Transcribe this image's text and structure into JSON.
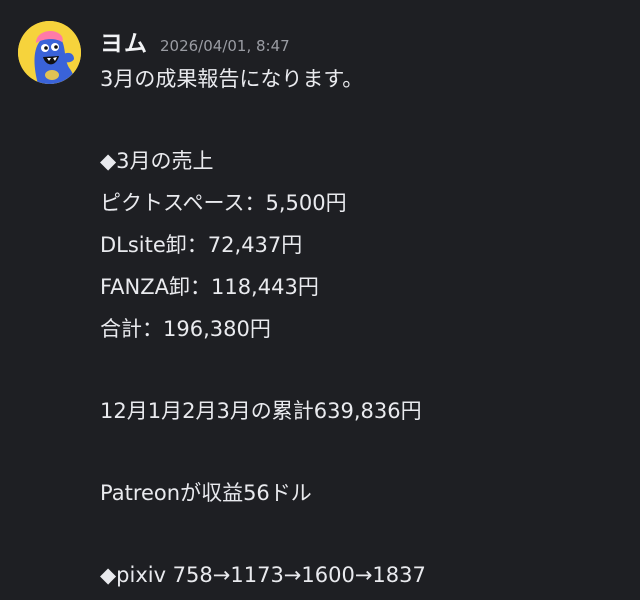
{
  "message": {
    "author": "ヨム",
    "timestamp": "2026/04/01, 8:47",
    "avatar_icon": "blue-monster-avatar-icon",
    "avatar_bg": "#f6d33c",
    "lines": [
      "3月の成果報告になります。",
      "",
      "◆3月の売上",
      "ピクトスペース：5,500円",
      "DLsite卸：72,437円",
      "FANZA卸：118,443円",
      "合計：196,380円",
      "",
      "12月1月2月3月の累計639,836円",
      "",
      "Patreonが収益56ドル",
      "",
      "◆pixiv 758→1173→1600→1837"
    ]
  }
}
